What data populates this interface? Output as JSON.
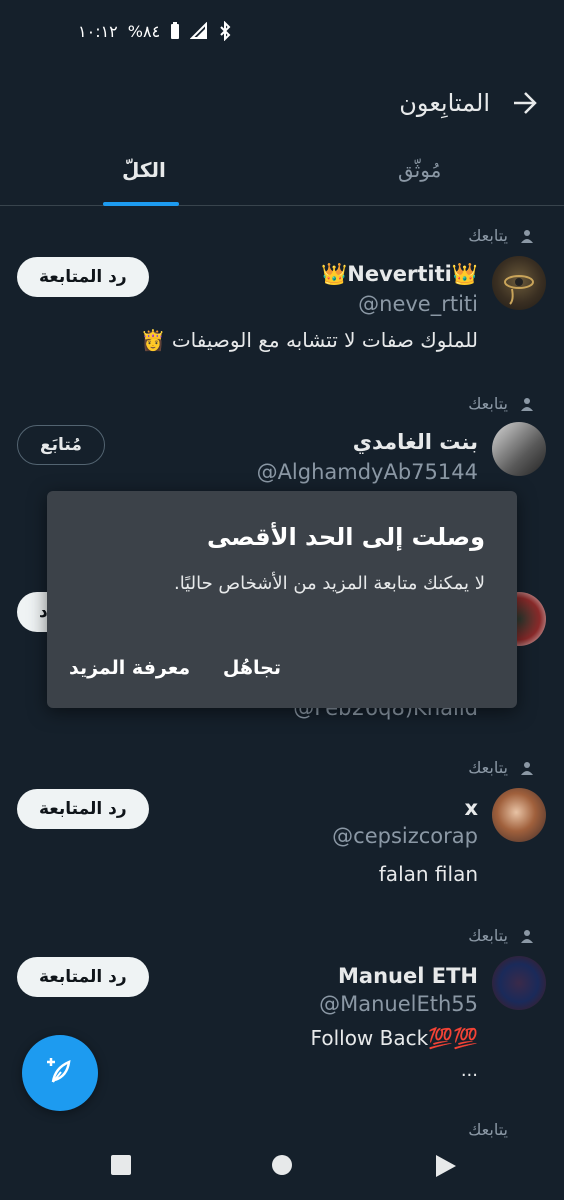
{
  "status_bar": {
    "time": "١٠:١٢",
    "battery": "%٨٤",
    "icons": [
      "battery-icon",
      "signal-icon",
      "bluetooth-icon"
    ]
  },
  "header": {
    "title": "المتابِعون",
    "back_icon": "arrow-right-icon"
  },
  "tabs": [
    {
      "label": "مُوثّق",
      "active": false
    },
    {
      "label": "الكلّ",
      "active": true
    }
  ],
  "followers": [
    {
      "follows_you": "يتابعك",
      "name": "👑Nevertiti👑",
      "handle": "@neve_rtiti",
      "bio": "للملوك صفات لا تتشابه مع الوصيفات 👸",
      "button": "رد المتابعة"
    },
    {
      "follows_you": "يتابعك",
      "name": "بنت الغامدي",
      "handle": "@AlghamdyAb75144",
      "bio": "",
      "button": "مُتابَع"
    },
    {
      "follows_you": "",
      "name": "",
      "handle": "@Feb26q8)Khalid",
      "bio": "",
      "button": "رد"
    },
    {
      "follows_you": "يتابعك",
      "name": "x",
      "handle": "@cepsizcorap",
      "bio": "falan filan",
      "button": "رد المتابعة"
    },
    {
      "follows_you": "يتابعك",
      "name": "Manuel ETH",
      "handle": "@ManuelEth55",
      "bio": "Follow Back💯💯",
      "bio_more": "...",
      "button": "رد المتابعة"
    },
    {
      "follows_you": "يتابعك"
    }
  ],
  "dialog": {
    "title": "وصلت إلى الحد الأقصى",
    "message": "لا يمكنك متابعة المزيد من الأشخاص حاليًا.",
    "dismiss": "تجاهُل",
    "learn_more": "معرفة المزيد"
  },
  "fab_icon": "compose-feather-icon",
  "nav": [
    "square-icon",
    "circle-icon",
    "triangle-icon"
  ],
  "colors": {
    "background": "#15202b",
    "accent": "#1d9bf0",
    "dialog": "#3c4249"
  }
}
